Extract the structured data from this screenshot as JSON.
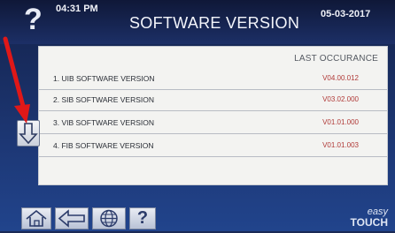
{
  "header": {
    "help_icon": "question-mark",
    "time": "04:31 PM",
    "title": "SOFTWARE VERSION",
    "date": "05-03-2017"
  },
  "table": {
    "column_header": "LAST OCCURANCE",
    "rows": [
      {
        "label": "1.   UIB SOFTWARE VERSION",
        "value": "V04.00.012"
      },
      {
        "label": "2.   SIB SOFTWARE VERSION",
        "value": "V03.02.000"
      },
      {
        "label": "3.   VIB SOFTWARE VERSION",
        "value": "V01.01.000"
      },
      {
        "label": "4.   FIB SOFTWARE VERSION",
        "value": "V01.01.003"
      }
    ]
  },
  "controls": {
    "scroll_down_icon": "arrow-down-icon"
  },
  "bottom_bar": {
    "home_icon": "home-icon",
    "back_icon": "back-arrow-icon",
    "language_icon": "globe-icon",
    "help_label": "?",
    "brand_line1": "easy",
    "brand_line2": "TOUCH"
  },
  "colors": {
    "annotation_arrow": "#e01818",
    "value_text": "#b03a38",
    "header_bg": "#0f1838"
  }
}
